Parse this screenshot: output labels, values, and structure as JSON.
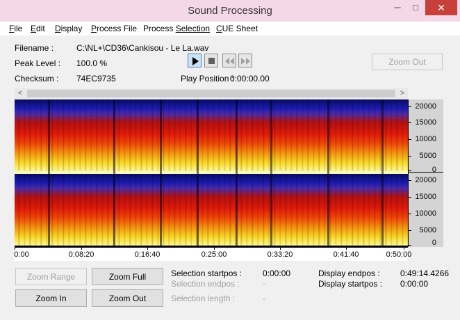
{
  "window": {
    "title": "Sound Processing",
    "min_glyph": "─",
    "max_glyph": "□",
    "close_glyph": "✕"
  },
  "menu": {
    "items": [
      {
        "key": "F",
        "rest": "ile"
      },
      {
        "key": "E",
        "rest": "dit"
      },
      {
        "key": "D",
        "rest": "isplay"
      },
      {
        "key": "P",
        "rest": "rocess File"
      },
      {
        "key": "Process ",
        "rest": "Selection",
        "underline_after": true,
        "full": "Process Selection"
      },
      {
        "key": "C",
        "rest": "UE Sheet"
      }
    ]
  },
  "info": {
    "filename_label": "Filename :",
    "filename_value": "C:\\NL+\\CD36\\Cankisou - Le La.wav",
    "peak_label": "Peak Level :",
    "peak_value": "100.0 %",
    "checksum_label": "Checksum :",
    "checksum_value": "74EC9735",
    "playpos_label": "Play Position :",
    "playpos_value": "0:00:00.00"
  },
  "transport": {
    "play_icon": "play-icon",
    "stop_icon": "stop-icon",
    "rewind_icon": "rewind-icon",
    "forward_icon": "fast-forward-icon"
  },
  "zoom_out_top": "Zoom Out",
  "scroll": {
    "left": "<",
    "right": ">"
  },
  "freq_labels": [
    "20000",
    "15000",
    "10000",
    "5000",
    "0"
  ],
  "time_labels": [
    "0:00",
    "0:08:20",
    "0:16:40",
    "0:25:00",
    "0:33:20",
    "0:41:40",
    "0:50:00"
  ],
  "buttons": {
    "zoom_range": "Zoom Range",
    "zoom_full": "Zoom Full",
    "zoom_in": "Zoom In",
    "zoom_out": "Zoom Out"
  },
  "selection": {
    "startpos_label": "Selection startpos :",
    "startpos_value": "0:00:00",
    "endpos_label": "Selection endpos :",
    "endpos_value": "-",
    "length_label": "Selection length :",
    "length_value": "-"
  },
  "display": {
    "endpos_label": "Display endpos :",
    "endpos_value": "0:49:14.4266",
    "startpos_label": "Display startpos :",
    "startpos_value": "0:00:00"
  },
  "colors": {
    "title_bar": "#f5d8e8",
    "close_button": "#c7403a",
    "spectrum_low": "#0a0b60",
    "spectrum_high": "#fff890"
  }
}
